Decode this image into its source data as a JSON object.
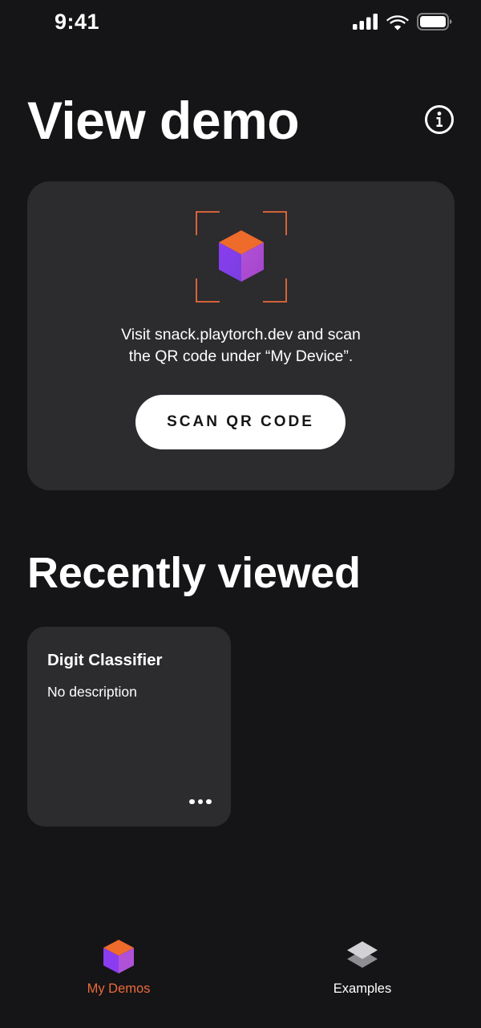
{
  "status_bar": {
    "time": "9:41",
    "icons": [
      "cellular-signal-icon",
      "wifi-icon",
      "battery-icon"
    ]
  },
  "header": {
    "title": "View demo",
    "info_icon": "info-icon"
  },
  "scan_card": {
    "icon": "cube-logo-icon",
    "instructions_line1": "Visit snack.playtorch.dev and scan",
    "instructions_line2": "the QR code under “My Device”.",
    "button_label": "SCAN QR CODE"
  },
  "recently_viewed": {
    "title": "Recently viewed",
    "items": [
      {
        "title": "Digit Classifier",
        "description": "No description",
        "more_icon": "more-horizontal-icon"
      }
    ]
  },
  "tab_bar": {
    "tabs": [
      {
        "label": "My Demos",
        "icon": "cube-logo-icon",
        "active": true
      },
      {
        "label": "Examples",
        "icon": "layers-icon",
        "active": false
      }
    ]
  },
  "colors": {
    "background": "#151416",
    "card": "#2c2b2e",
    "accent": "#ea6b3a",
    "cube_top": "#ee6b2c",
    "cube_side": "#8f4ee8"
  }
}
